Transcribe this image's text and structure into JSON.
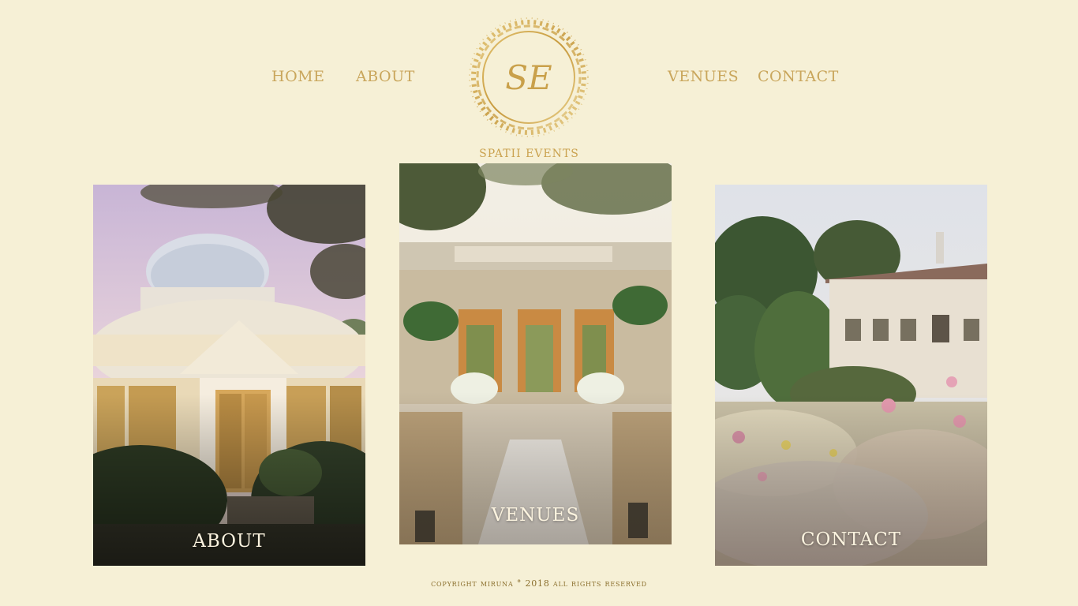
{
  "nav": {
    "home": "HOME",
    "about": "ABOUT",
    "venues": "VENUES",
    "contact": "CONTACT"
  },
  "logo": {
    "monogram": "SE",
    "name": "SPATII EVENTS"
  },
  "cards": [
    {
      "label": "ABOUT",
      "image": "glass conservatory photo"
    },
    {
      "label": "VENUES",
      "image": "garden ceremony aisle photo"
    },
    {
      "label": "CONTACT",
      "image": "villa and tulip garden photo"
    }
  ],
  "footer": {
    "text": "copyright miruna ° 2018 all rights reserved"
  },
  "colors": {
    "background": "#f6f0d6",
    "accent_gold": "#c9a65c",
    "footer_text": "#8a6e2c",
    "card_label": "#fbf3df"
  }
}
